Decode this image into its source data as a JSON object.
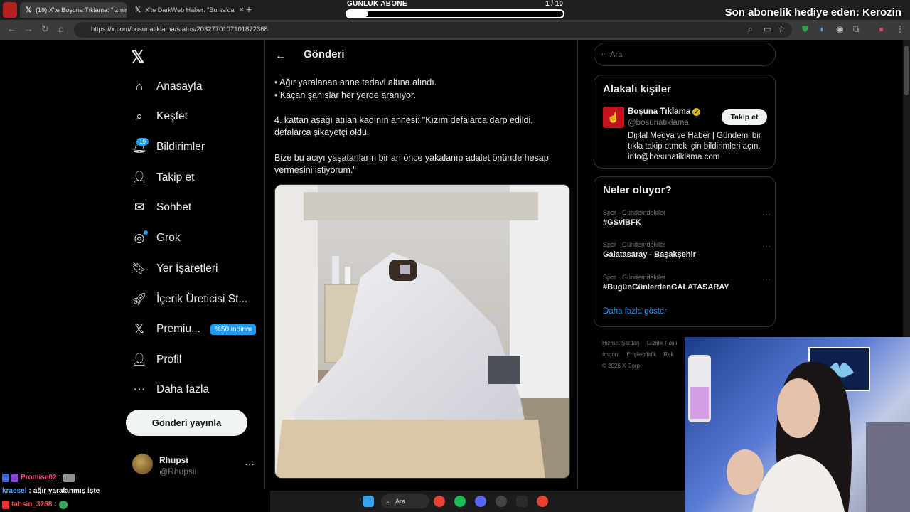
{
  "browser": {
    "tabs": [
      {
        "label": "(19) X'te Boşuna Tıklama: \"İzmir"
      },
      {
        "label": "X'te DarkWeb Haber: \"Bursa'da"
      }
    ],
    "url": "https://x.com/bosunatiklama/status/2032770107101872368"
  },
  "overlay": {
    "sub_label": "GÜNLÜK ABONE",
    "sub_count": "1 / 10",
    "sub_progress": 0.1,
    "gift_text": "Son abonelik hediye eden: Kerozin"
  },
  "nav": {
    "items": [
      {
        "label": "Anasayfa",
        "icon": "home-icon"
      },
      {
        "label": "Keşfet",
        "icon": "search-icon"
      },
      {
        "label": "Bildirimler",
        "icon": "bell-icon"
      },
      {
        "label": "Takip et",
        "icon": "add-user-icon"
      },
      {
        "label": "Sohbet",
        "icon": "mail-icon"
      },
      {
        "label": "Grok",
        "icon": "grok-icon"
      },
      {
        "label": "Yer İşaretleri",
        "icon": "bookmark-icon"
      },
      {
        "label": "İçerik Üreticisi St...",
        "icon": "rocket-icon"
      },
      {
        "label": "Premiu...",
        "icon": "x-icon"
      },
      {
        "label": "Profil",
        "icon": "person-icon"
      },
      {
        "label": "Daha fazla",
        "icon": "more-circle-icon"
      }
    ],
    "notifications_count": "19",
    "premium_badge": "%50 indirim",
    "post_button": "Gönderi yayınla",
    "account": {
      "name": "Rhupsi",
      "handle": "@Rhupsii"
    }
  },
  "main": {
    "title": "Gönderi",
    "paragraphs": [
      "• Ağır yaralanan anne tedavi altına alındı.\n• Kaçan şahıslar her yerde aranıyor.",
      "4. kattan aşağı atılan kadının annesi: \"Kızım defalarca darp edildi, defalarca şikayetçi oldu.",
      "Bize bu acıyı yaşatanların bir an önce yakalanıp adalet önünde hesap vermesini istiyorum.\""
    ]
  },
  "right": {
    "search_placeholder": "Ara",
    "related_title": "Alakalı kişiler",
    "related": {
      "name": "Boşuna Tıklama",
      "handle": "@bosunatiklama",
      "follow_label": "Takip et",
      "bio": "Dijital Medya ve Haber | Gündemi bir tıkla takip etmek için bildirimleri açın. info@bosunatiklama.com"
    },
    "trends_title": "Neler oluyor?",
    "trends": [
      {
        "category": "Spor · Gündemdekiler",
        "tag": "#GSviBFK"
      },
      {
        "category": "Spor · Gündemdekiler",
        "tag": "Galatasaray - Başakşehir"
      },
      {
        "category": "Spor · Gündemdekiler",
        "tag": "#BugünGünlerdenGALATASARAY"
      }
    ],
    "show_more": "Daha fazla göster",
    "footer": [
      "Hizmet Şartları",
      "Gizlilik Politi",
      "Imprint",
      "Erişilebilirlik",
      "Rek",
      "© 2026 X Corp."
    ]
  },
  "chat": [
    {
      "user": "Promise02",
      "text": "",
      "color": "#ff3c8c"
    },
    {
      "user": "kraesel",
      "text": "ağır yaralanmış işte",
      "color": "#4ea6ff"
    },
    {
      "user": "tahsin_3268",
      "text": "",
      "color": "#ff4b4b"
    }
  ],
  "taskbar": {
    "search_label": "Ara"
  }
}
